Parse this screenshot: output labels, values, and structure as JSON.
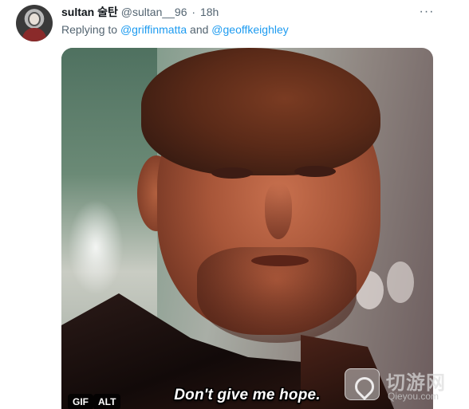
{
  "tweet": {
    "display_name": "sultan 술탄",
    "handle": "@sultan__96",
    "separator": "·",
    "time": "18h",
    "more_icon": "···",
    "replying_prefix": "Replying to",
    "mention_1": "@griffinmatta",
    "mention_joiner": "and",
    "mention_2": "@geoffkeighley"
  },
  "media": {
    "caption": "Don't give me hope.",
    "gif_badge": "GIF",
    "alt_badge": "ALT"
  },
  "watermark": {
    "text": "切游网",
    "url": "Qieyou.com"
  },
  "colors": {
    "link": "#1d9bf0",
    "secondary_text": "#536471",
    "primary_text": "#0f1419"
  }
}
